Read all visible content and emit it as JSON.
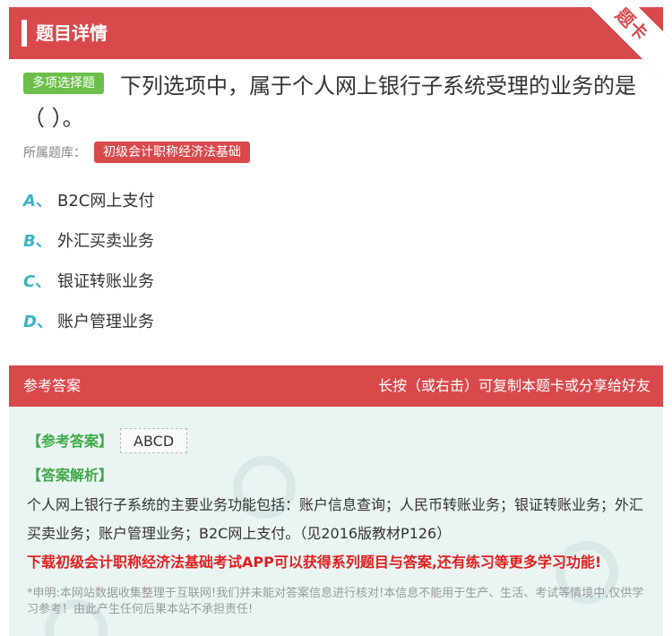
{
  "header": {
    "title": "题目详情",
    "corner_label": "题卡"
  },
  "question": {
    "type_tag": "多项选择题",
    "text": "下列选项中，属于个人网上银行子系统受理的业务的是（ ）。",
    "bank_label": "所属题库：",
    "bank_name": "初级会计职称经济法基础"
  },
  "options": [
    {
      "letter": "A",
      "sep": "、",
      "text": "B2C网上支付"
    },
    {
      "letter": "B",
      "sep": "、",
      "text": "外汇买卖业务"
    },
    {
      "letter": "C",
      "sep": "、",
      "text": "银证转账业务"
    },
    {
      "letter": "D",
      "sep": "、",
      "text": "账户管理业务"
    }
  ],
  "answer": {
    "header_left": "参考答案",
    "header_right": "长按（或右击）可复制本题卡或分享给好友",
    "answer_label": "【参考答案】",
    "answer_value": "ABCD",
    "analysis_label": "【答案解析】",
    "analysis_text": "个人网上银行子系统的主要业务功能包括：账户信息查询；人民币转账业务；银证转账业务；外汇买卖业务；账户管理业务；B2C网上支付。（见2016版教材P126）",
    "download_text": "下载初级会计职称经济法基础考试APP可以获得系列题目与答案,还有练习等更多学习功能!",
    "disclaimer": "*申明:本网站数据收集整理于互联网!我们并未能对答案信息进行核对!本信息不能用于生产、生活、考试等情境中,仅供学习参考！由此产生任何后果本站不承担责任!"
  },
  "colors": {
    "brand_red": "#d9494c",
    "option_letter": "#37b6c2",
    "green": "#40a84a",
    "answer_bg": "#eaf5f3"
  }
}
